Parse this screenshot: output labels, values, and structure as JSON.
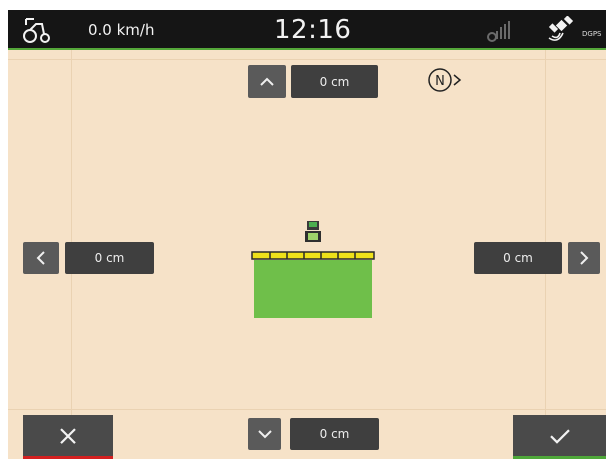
{
  "statusbar": {
    "speed": "0.0 km/h",
    "time": "12:16",
    "gps_label": "DGPS"
  },
  "offsets": {
    "front": "0 cm",
    "rear": "0 cm",
    "left": "0 cm",
    "right": "0 cm"
  },
  "compass": {
    "label": "N"
  },
  "icons": {
    "tractor": "tractor-icon",
    "signal": "signal-bars-icon",
    "gps": "gps-satellite-icon",
    "north": "north-indicator-icon",
    "up": "chevron-up-icon",
    "down": "chevron-down-icon",
    "left": "chevron-left-icon",
    "right": "chevron-right-icon",
    "cancel": "close-icon",
    "confirm": "checkmark-icon"
  },
  "colors": {
    "background": "#f6e2c8",
    "statusbar": "#151515",
    "button": "#4a4a4a",
    "field_green": "#6fbf4a",
    "boom_yellow": "#f0e21a",
    "cancel_accent": "#d42020",
    "confirm_accent": "#4fa83a"
  }
}
